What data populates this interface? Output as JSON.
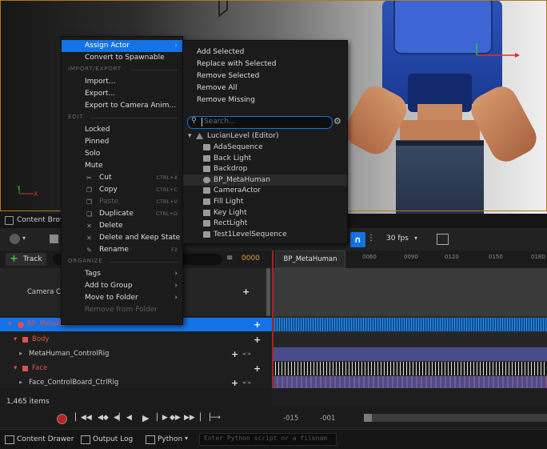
{
  "viewport": {
    "axis_x": "X",
    "axis_y": "Y",
    "colors": {
      "accent": "#1473e6",
      "border": "#b07a18"
    }
  },
  "context_menu": {
    "items": [
      {
        "label": "Assign Actor",
        "submenu": true
      },
      {
        "label": "Convert to Spawnable"
      }
    ],
    "sections": [
      {
        "title": "IMPORT/EXPORT",
        "items": [
          {
            "label": "Import..."
          },
          {
            "label": "Export..."
          },
          {
            "label": "Export to Camera Anim..."
          }
        ]
      },
      {
        "title": "EDIT",
        "items": [
          {
            "label": "Locked"
          },
          {
            "label": "Pinned"
          },
          {
            "label": "Solo"
          },
          {
            "label": "Mute"
          },
          {
            "label": "Cut",
            "shortcut": "CTRL+X",
            "icon": "cut-icon"
          },
          {
            "label": "Copy",
            "shortcut": "CTRL+C",
            "icon": "copy-icon"
          },
          {
            "label": "Paste",
            "shortcut": "CTRL+V",
            "icon": "paste-icon",
            "disabled": true
          },
          {
            "label": "Duplicate",
            "shortcut": "CTRL+D",
            "icon": "duplicate-icon"
          },
          {
            "label": "Delete",
            "icon": "delete-icon"
          },
          {
            "label": "Delete and Keep State",
            "icon": "delete-icon"
          },
          {
            "label": "Rename",
            "shortcut": "F2",
            "icon": "rename-icon"
          }
        ]
      },
      {
        "title": "ORGANIZE",
        "items": [
          {
            "label": "Tags",
            "submenu": true
          },
          {
            "label": "Add to Group",
            "submenu": true
          },
          {
            "label": "Move to Folder",
            "submenu": true
          },
          {
            "label": "Remove from Folder",
            "disabled": true
          }
        ]
      }
    ]
  },
  "assign_submenu": {
    "actions": [
      "Add Selected",
      "Replace with Selected",
      "Remove Selected",
      "Remove All",
      "Remove Missing"
    ],
    "search_placeholder": "Search...",
    "root": "LucianLevel (Editor)",
    "actors": [
      "AdaSequence",
      "Back Light",
      "Backdrop",
      "BP_MetaHuman",
      "CameraActor",
      "Fill Light",
      "Key Light",
      "RectLight",
      "Test1LevelSequence"
    ]
  },
  "content_browser": {
    "title": "Content Brow"
  },
  "sequencer": {
    "track_button": "Track",
    "frame_value": "0000",
    "fps": "30 fps",
    "tooltip": "BP_MetaHuman",
    "ruler_ticks": [
      "0060",
      "0090",
      "0120",
      "0150",
      "0180"
    ],
    "tracks": [
      {
        "label": "Camera Cut"
      },
      {
        "label": "BP_MetaHuman"
      },
      {
        "label": "Body"
      },
      {
        "label": "MetaHuman_ControlRig"
      },
      {
        "label": "Face"
      },
      {
        "label": "Face_ControlBoard_CtrlRig"
      }
    ],
    "items_count": "1,465 items",
    "range_start": "-015",
    "range_current": "-001"
  },
  "status_bar": {
    "content_drawer": "Content Drawer",
    "output_log": "Output Log",
    "python": "Python",
    "command_placeholder": "Enter Python script or a filenam"
  }
}
